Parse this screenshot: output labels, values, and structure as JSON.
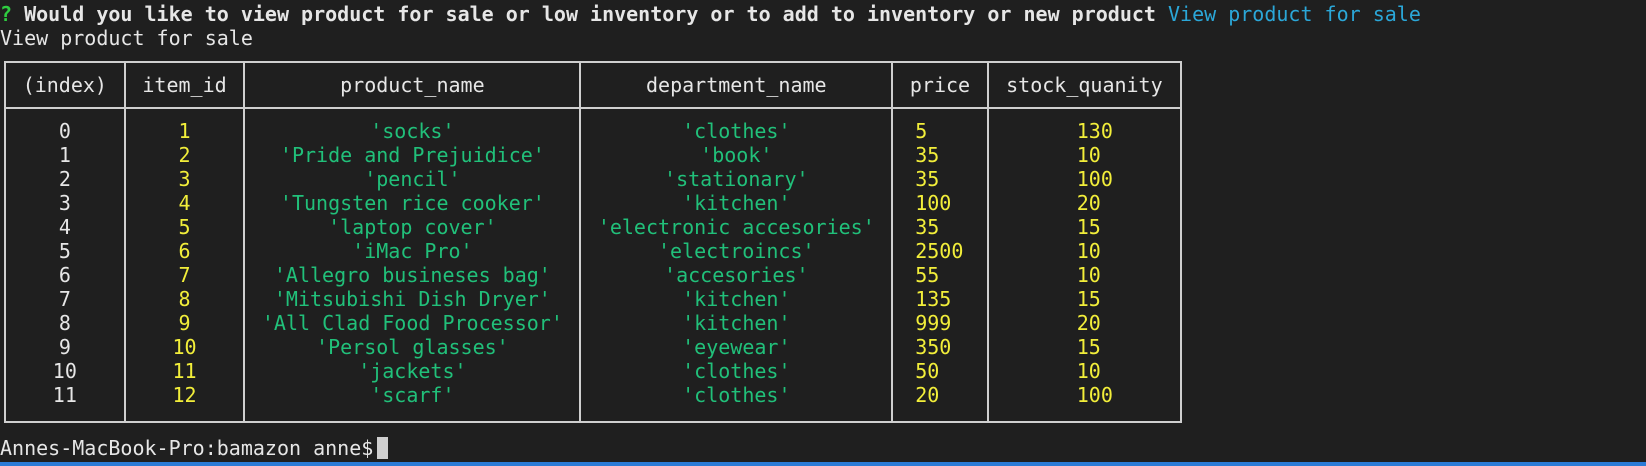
{
  "prompt": {
    "marker": "?",
    "question": "Would you like to view product for sale or low inventory or to add to inventory or new product",
    "answer": "View product for sale"
  },
  "echo": "View product for sale",
  "table": {
    "headers": [
      "(index)",
      "item_id",
      "product_name",
      "department_name",
      "price",
      "stock_quanity"
    ],
    "rows": [
      {
        "index": "0",
        "item_id": "1",
        "product_name": "'socks'",
        "department_name": "'clothes'",
        "price": "5",
        "stock": "130"
      },
      {
        "index": "1",
        "item_id": "2",
        "product_name": "'Pride and Prejuidice'",
        "department_name": "'book'",
        "price": "35",
        "stock": "10"
      },
      {
        "index": "2",
        "item_id": "3",
        "product_name": "'pencil'",
        "department_name": "'stationary'",
        "price": "35",
        "stock": "100"
      },
      {
        "index": "3",
        "item_id": "4",
        "product_name": "'Tungsten rice cooker'",
        "department_name": "'kitchen'",
        "price": "100",
        "stock": "20"
      },
      {
        "index": "4",
        "item_id": "5",
        "product_name": "'laptop cover'",
        "department_name": "'electronic accesories'",
        "price": "35",
        "stock": "15"
      },
      {
        "index": "5",
        "item_id": "6",
        "product_name": "'iMac Pro'",
        "department_name": "'electroincs'",
        "price": "2500",
        "stock": "10"
      },
      {
        "index": "6",
        "item_id": "7",
        "product_name": "'Allegro busineses bag'",
        "department_name": "'accesories'",
        "price": "55",
        "stock": "10"
      },
      {
        "index": "7",
        "item_id": "8",
        "product_name": "'Mitsubishi Dish Dryer'",
        "department_name": "'kitchen'",
        "price": "135",
        "stock": "15"
      },
      {
        "index": "8",
        "item_id": "9",
        "product_name": "'All Clad Food Processor'",
        "department_name": "'kitchen'",
        "price": "999",
        "stock": "20"
      },
      {
        "index": "9",
        "item_id": "10",
        "product_name": "'Persol glasses'",
        "department_name": "'eyewear'",
        "price": "350",
        "stock": "15"
      },
      {
        "index": "10",
        "item_id": "11",
        "product_name": "'jackets'",
        "department_name": "'clothes'",
        "price": "50",
        "stock": "10"
      },
      {
        "index": "11",
        "item_id": "12",
        "product_name": "'scarf'",
        "department_name": "'clothes'",
        "price": "20",
        "stock": "100"
      }
    ]
  },
  "shell_prompt": "Annes-MacBook-Pro:bamazon anne$",
  "colors": {
    "background": "#1f1f1f",
    "prompt_marker": "#2ecc40",
    "answer": "#2ba7d8",
    "string_values": "#21c07a",
    "number_values": "#f2ee3a"
  }
}
